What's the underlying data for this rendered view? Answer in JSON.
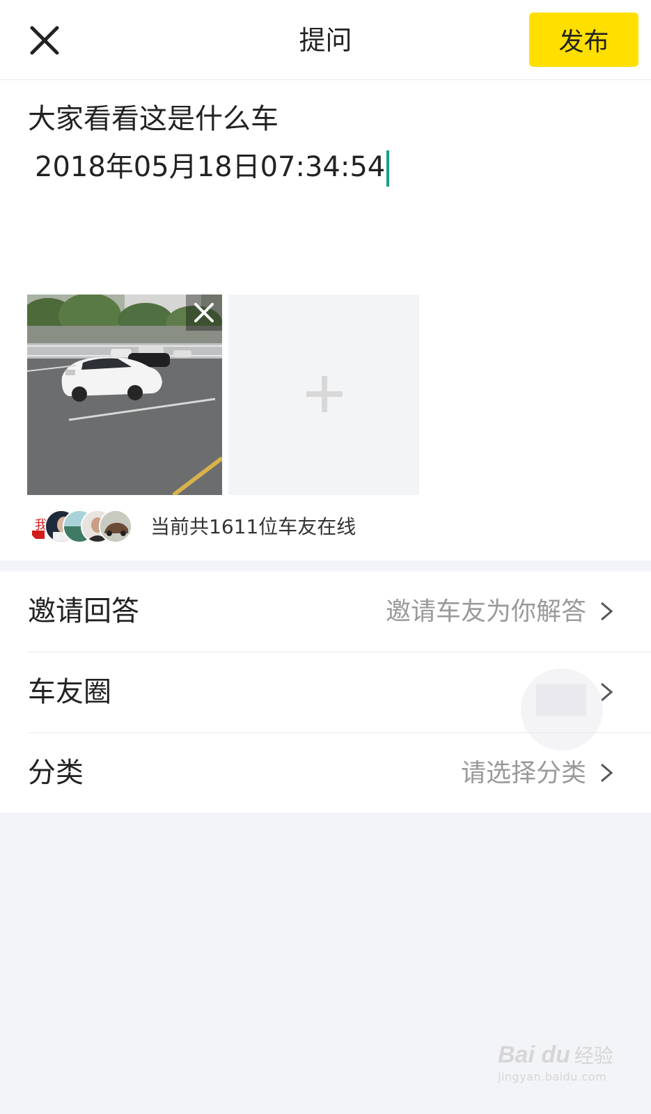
{
  "header": {
    "title": "提问",
    "publish_label": "发布"
  },
  "compose": {
    "question_line1": "大家看看这是什么车",
    "question_line2": "2018年05月18日07:34:54"
  },
  "online": {
    "text": "当前共1611位车友在线",
    "avatar_badge_text": "我"
  },
  "settings": {
    "rows": [
      {
        "label": "邀请回答",
        "value": "邀请车友为你解答"
      },
      {
        "label": "车友圈",
        "value": ""
      },
      {
        "label": "分类",
        "value": "请选择分类"
      }
    ]
  },
  "watermark": {
    "brand": "Bai du",
    "suffix": "经验",
    "url": "jingyan.baidu.com"
  },
  "colors": {
    "publish_button": "#ffdf00",
    "caret": "#1a9e86",
    "background": "#f3f4f7"
  }
}
